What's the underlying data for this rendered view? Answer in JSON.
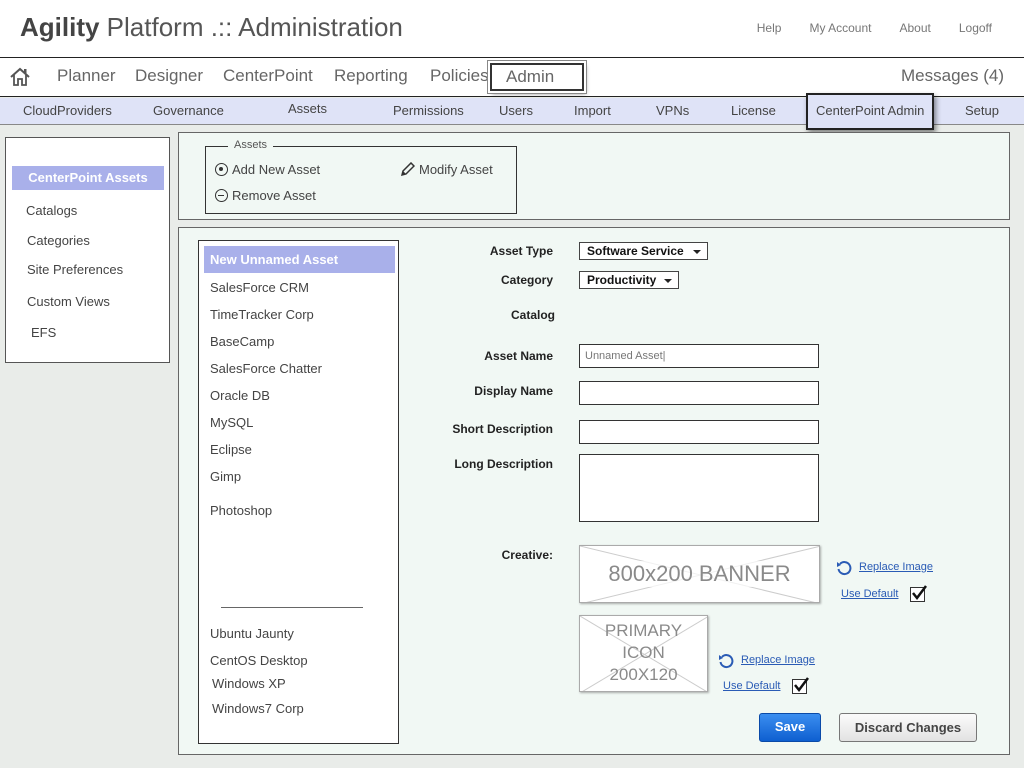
{
  "header": {
    "brand": "Agility",
    "title_rest": " Platform .:: Administration",
    "links": [
      "Help",
      "My Account",
      "About",
      "Logoff"
    ]
  },
  "mainnav": {
    "home_icon": "home-icon",
    "items": [
      "Planner",
      "Designer",
      "CenterPoint",
      "Reporting",
      "Policies",
      "Admin"
    ],
    "active": "Admin",
    "messages": "Messages (4)"
  },
  "subnav": {
    "items": [
      "CloudProviders",
      "Governance",
      "Assets",
      "Permissions",
      "Users",
      "Import",
      "VPNs",
      "License",
      "CenterPoint Admin",
      "Setup"
    ],
    "active": "CenterPoint Admin"
  },
  "sidebar": {
    "title": "CenterPoint Assets",
    "items": [
      "Catalogs",
      "Categories",
      "Site Preferences",
      "Custom Views",
      "EFS"
    ]
  },
  "actions": {
    "legend": "Assets",
    "add": "Add New Asset",
    "modify": "Modify Asset",
    "remove": "Remove Asset"
  },
  "asset_list": {
    "selected": "New Unnamed Asset",
    "items": [
      "SalesForce CRM",
      "TimeTracker Corp",
      "BaseCamp",
      "SalesForce Chatter",
      "Oracle DB",
      "MySQL",
      "Eclipse",
      "Gimp",
      "Photoshop"
    ],
    "items_bottom": [
      "Ubuntu Jaunty",
      "CentOS Desktop",
      "Windows XP",
      "Windows7 Corp"
    ]
  },
  "form": {
    "asset_type_label": "Asset Type",
    "asset_type_value": "Software Service",
    "category_label": "Category",
    "category_value": "Productivity",
    "catalog_label": "Catalog",
    "asset_name_label": "Asset Name",
    "asset_name_value": "Unnamed Asset|",
    "display_name_label": "Display Name",
    "display_name_value": "",
    "short_desc_label": "Short Description",
    "short_desc_value": "",
    "long_desc_label": "Long Description",
    "long_desc_value": "",
    "creative_label": "Creative:",
    "banner_text": "800x200 BANNER",
    "icon_text_lines": [
      "PRIMARY",
      "ICON",
      "200X120"
    ],
    "replace_image": "Replace Image",
    "use_default": "Use Default",
    "banner_use_default_checked": true,
    "icon_use_default_checked": true
  },
  "buttons": {
    "save": "Save",
    "discard": "Discard Changes"
  }
}
